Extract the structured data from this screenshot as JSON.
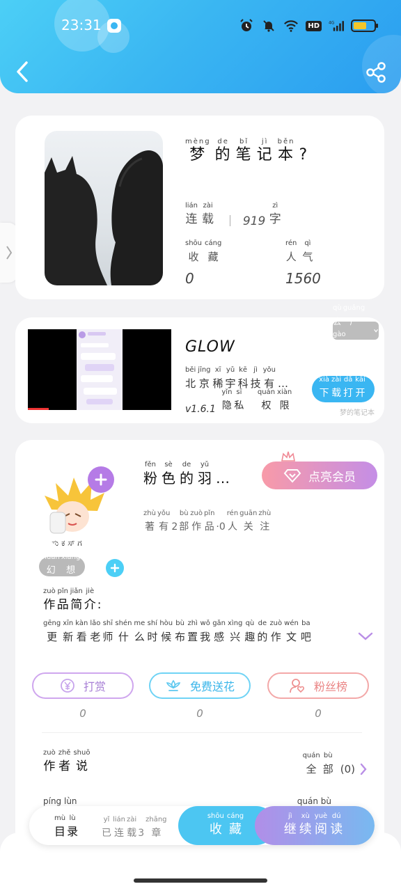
{
  "status_bar": {
    "time": "23:31",
    "icons": [
      "camera-icon",
      "alarm-icon",
      "mute-icon",
      "wifi-icon",
      "hd-badge",
      "signal-4g-icon",
      "battery-icon"
    ],
    "hd_label": "HD"
  },
  "header": {
    "back_icon": "chevron-left-icon",
    "share_icon": "share-icon",
    "gradient": [
      "#4ccff6",
      "#2a9df0"
    ]
  },
  "book": {
    "title_chars": [
      {
        "py": "mèng",
        "hz": "梦"
      },
      {
        "py": "de",
        "hz": "的"
      },
      {
        "py": "bǐ",
        "hz": "笔"
      },
      {
        "py": "jì",
        "hz": "记"
      },
      {
        "py": "běn",
        "hz": "本"
      },
      {
        "py": "",
        "hz": "?"
      }
    ],
    "status_chars": [
      {
        "py": "lián",
        "hz": "连"
      },
      {
        "py": "zài",
        "hz": "载"
      }
    ],
    "word_count": "919",
    "word_unit": {
      "py": "zì",
      "hz": "字"
    },
    "collect_label": [
      {
        "py": "shōu",
        "hz": "收"
      },
      {
        "py": "cáng",
        "hz": "藏"
      }
    ],
    "popularity_label": [
      {
        "py": "rén",
        "hz": "人"
      },
      {
        "py": "qì",
        "hz": "气"
      }
    ],
    "collect_value": "0",
    "popularity_value": "1560"
  },
  "ad": {
    "title": "GLOW",
    "company_chars": [
      {
        "py": "běi",
        "hz": "北"
      },
      {
        "py": "jīng",
        "hz": "京"
      },
      {
        "py": "xī",
        "hz": "稀"
      },
      {
        "py": "yǔ",
        "hz": "宇"
      },
      {
        "py": "kē",
        "hz": "科"
      },
      {
        "py": "jì",
        "hz": "技"
      },
      {
        "py": "yǒu",
        "hz": "有"
      },
      {
        "py": "",
        "hz": "…"
      }
    ],
    "version": "v1.6.1",
    "privacy_chars": [
      {
        "py": "yǐn",
        "hz": "隐"
      },
      {
        "py": "sī",
        "hz": "私"
      }
    ],
    "permission_chars": [
      {
        "py": "quán",
        "hz": "权"
      },
      {
        "py": "xiàn",
        "hz": "限"
      }
    ],
    "tag_chars": [
      {
        "py": "qù",
        "hz": "去"
      },
      {
        "py": "guǎng",
        "hz": "广"
      },
      {
        "py": "gào",
        "hz": "告"
      }
    ],
    "download_chars": [
      {
        "py": "xià",
        "hz": "下"
      },
      {
        "py": "zài",
        "hz": "载"
      },
      {
        "py": "dǎ",
        "hz": "打"
      },
      {
        "py": "kāi",
        "hz": "开"
      }
    ],
    "small_text": "梦的笔记本"
  },
  "author": {
    "name_chars": [
      {
        "py": "fěn",
        "hz": "粉"
      },
      {
        "py": "sè",
        "hz": "色"
      },
      {
        "py": "de",
        "hz": "的"
      },
      {
        "py": "yǔ",
        "hz": "羽"
      },
      {
        "py": "",
        "hz": "…"
      }
    ],
    "meta_chars": [
      {
        "py": "zhù",
        "hz": "著"
      },
      {
        "py": "yǒu",
        "hz": "有"
      },
      {
        "py": "",
        "hz": "2"
      },
      {
        "py": "bù",
        "hz": "部"
      },
      {
        "py": "zuò",
        "hz": "作"
      },
      {
        "py": "pǐn",
        "hz": "品"
      },
      {
        "py": "",
        "hz": "·0"
      },
      {
        "py": "rén",
        "hz": "人"
      },
      {
        "py": "guān",
        "hz": "关"
      },
      {
        "py": "zhù",
        "hz": "注"
      }
    ],
    "vip_label": "点亮会员",
    "tag_chars": [
      {
        "py": "huàn",
        "hz": "幻"
      },
      {
        "py": "xiǎng",
        "hz": "想"
      }
    ],
    "intro_heading_chars": [
      {
        "py": "zuò",
        "hz": "作"
      },
      {
        "py": "pǐn",
        "hz": "品"
      },
      {
        "py": "jiǎn",
        "hz": "简"
      },
      {
        "py": "jiè",
        "hz": "介"
      },
      {
        "py": "",
        "hz": ":"
      }
    ],
    "intro_chars": [
      {
        "py": "gēng",
        "hz": "更"
      },
      {
        "py": "xīn",
        "hz": "新"
      },
      {
        "py": "kàn",
        "hz": "看"
      },
      {
        "py": "lǎo",
        "hz": "老"
      },
      {
        "py": "shī",
        "hz": "师"
      },
      {
        "py": "shén",
        "hz": "什"
      },
      {
        "py": "me",
        "hz": "么"
      },
      {
        "py": "shí",
        "hz": "时"
      },
      {
        "py": "hòu",
        "hz": "候"
      },
      {
        "py": "bù",
        "hz": "布"
      },
      {
        "py": "zhì",
        "hz": "置"
      },
      {
        "py": "wǒ",
        "hz": "我"
      },
      {
        "py": "gǎn",
        "hz": "感"
      },
      {
        "py": "xìng",
        "hz": "兴"
      },
      {
        "py": "qù",
        "hz": "趣"
      },
      {
        "py": "de",
        "hz": "的"
      },
      {
        "py": "zuò",
        "hz": "作"
      },
      {
        "py": "wén",
        "hz": "文"
      },
      {
        "py": "ba",
        "hz": "吧"
      }
    ]
  },
  "actions": [
    {
      "label": "打赏",
      "icon": "yen-coin-icon",
      "count": "0",
      "color": "#a880d6"
    },
    {
      "label": "免费送花",
      "icon": "flower-icon",
      "count": "0",
      "color": "#3bb6ea"
    },
    {
      "label": "粉丝榜",
      "icon": "fan-user-icon",
      "count": "0",
      "color": "#ea8585"
    }
  ],
  "author_says": {
    "title_chars": [
      {
        "py": "zuò",
        "hz": "作"
      },
      {
        "py": "zhě",
        "hz": "者"
      },
      {
        "py": "shuō",
        "hz": "说"
      }
    ],
    "all_chars": [
      {
        "py": "quán",
        "hz": "全"
      },
      {
        "py": "bù",
        "hz": "部"
      }
    ],
    "all_count": "(0)"
  },
  "comments_peek": {
    "title_py": "píng  lùn",
    "right_py": "quán  bù"
  },
  "bottom_bar": {
    "catalog_chars": [
      {
        "py": "mù",
        "hz": "目"
      },
      {
        "py": "lù",
        "hz": "录"
      }
    ],
    "updated_chars": [
      {
        "py": "yǐ",
        "hz": "已"
      },
      {
        "py": "lián",
        "hz": "连"
      },
      {
        "py": "zài",
        "hz": "载"
      },
      {
        "py": "",
        "hz": "3"
      },
      {
        "py": "zhāng",
        "hz": "章"
      }
    ],
    "collect_chars": [
      {
        "py": "shōu",
        "hz": "收"
      },
      {
        "py": "cáng",
        "hz": "藏"
      }
    ],
    "read_chars": [
      {
        "py": "jì",
        "hz": "继"
      },
      {
        "py": "xù",
        "hz": "续"
      },
      {
        "py": "yuè",
        "hz": "阅"
      },
      {
        "py": "dú",
        "hz": "读"
      }
    ]
  }
}
